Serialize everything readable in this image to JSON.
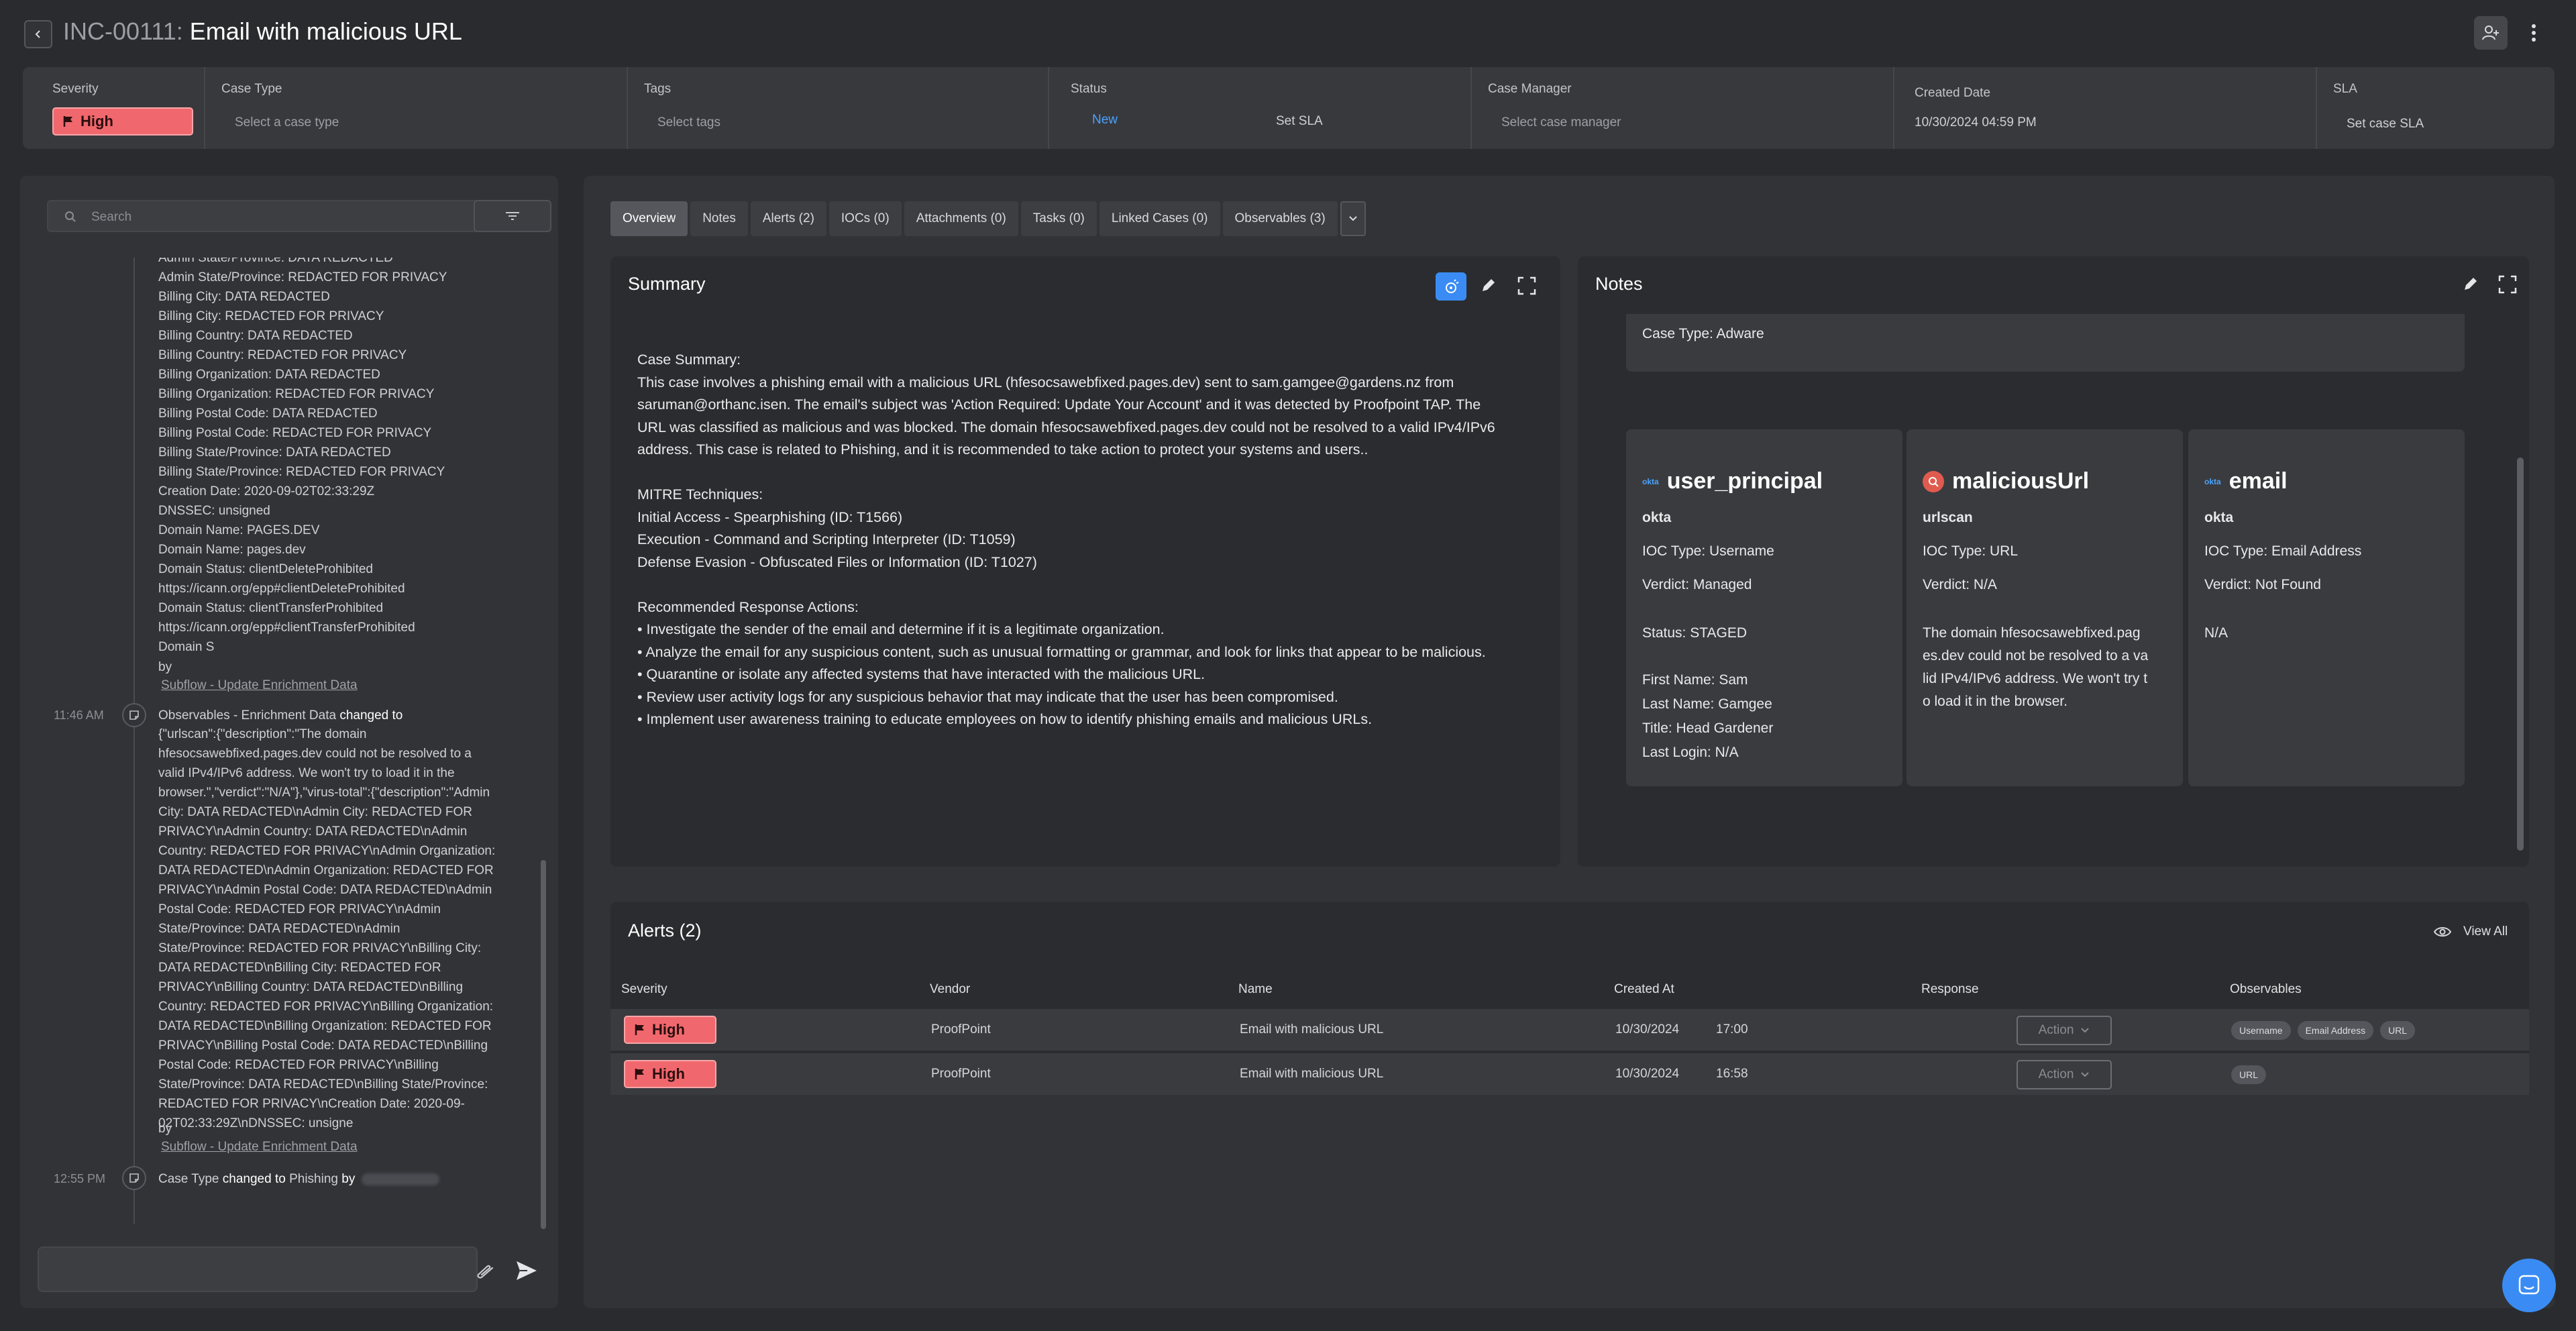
{
  "header": {
    "case_id": "INC-00111:",
    "case_title": "Email with malicious URL"
  },
  "fields": {
    "severity_label": "Severity",
    "severity_value": "High",
    "case_type_label": "Case Type",
    "case_type_placeholder": "Select a case type",
    "tags_label": "Tags",
    "tags_placeholder": "Select tags",
    "status_label": "Status",
    "status_value": "New",
    "set_sla": "Set SLA",
    "case_manager_label": "Case Manager",
    "case_manager_placeholder": "Select case manager",
    "created_label": "Created Date",
    "created_value": "10/30/2024 04:59 PM",
    "sla_label": "SLA",
    "sla_placeholder": "Set case SLA"
  },
  "activity": {
    "search_placeholder": "Search",
    "lines": [
      "Admin State/Province: DATA REDACTED",
      "Admin State/Province: REDACTED FOR PRIVACY",
      "Billing City: DATA REDACTED",
      "Billing City: REDACTED FOR PRIVACY",
      "Billing Country: DATA REDACTED",
      "Billing Country: REDACTED FOR PRIVACY",
      "Billing Organization: DATA REDACTED",
      "Billing Organization: REDACTED FOR PRIVACY",
      "Billing Postal Code: DATA REDACTED",
      "Billing Postal Code: REDACTED FOR PRIVACY",
      "Billing State/Province: DATA REDACTED",
      "Billing State/Province: REDACTED FOR PRIVACY",
      "Creation Date: 2020-09-02T02:33:29Z",
      "DNSSEC: unsigned",
      "Domain Name: PAGES.DEV",
      "Domain Name: pages.dev",
      "Domain Status: clientDeleteProhibited",
      "https://icann.org/epp#clientDeleteProhibited",
      "Domain Status: clientTransferProhibited",
      "https://icann.org/epp#clientTransferProhibited",
      "Domain S"
    ],
    "by": "by",
    "link1": "Subflow - Update Enrichment Data",
    "entry2_time": "11:46 AM",
    "entry2_subject": "Observables - Enrichment Data",
    "entry2_changed": "changed to",
    "entry2_lines": [
      "{\"urlscan\":{\"description\":\"The domain",
      "hfesocsawebfixed.pages.dev could not be resolved to a",
      "valid IPv4/IPv6 address. We won't try to load it in the",
      "browser.\",\"verdict\":\"N/A\"},\"virus-total\":{\"description\":\"Admin",
      "City: DATA REDACTED\\nAdmin City: REDACTED FOR",
      "PRIVACY\\nAdmin Country: DATA REDACTED\\nAdmin",
      "Country: REDACTED FOR PRIVACY\\nAdmin Organization:",
      "DATA REDACTED\\nAdmin Organization: REDACTED FOR",
      "PRIVACY\\nAdmin Postal Code: DATA REDACTED\\nAdmin",
      "Postal Code: REDACTED FOR PRIVACY\\nAdmin",
      "State/Province: DATA REDACTED\\nAdmin",
      "State/Province: REDACTED FOR PRIVACY\\nBilling City:",
      "DATA REDACTED\\nBilling City: REDACTED FOR",
      "PRIVACY\\nBilling Country: DATA REDACTED\\nBilling",
      "Country: REDACTED FOR PRIVACY\\nBilling Organization:",
      "DATA REDACTED\\nBilling Organization: REDACTED FOR",
      "PRIVACY\\nBilling Postal Code: DATA REDACTED\\nBilling",
      "Postal Code: REDACTED FOR PRIVACY\\nBilling",
      "State/Province: DATA REDACTED\\nBilling State/Province:",
      "REDACTED FOR PRIVACY\\nCreation Date: 2020-09-",
      "02T02:33:29Z\\nDNSSEC: unsigne"
    ],
    "link2": "Subflow - Update Enrichment Data",
    "entry3_time": "12:55 PM",
    "entry3_subject": "Case Type",
    "entry3_changed": "changed to",
    "entry3_value": "Phishing",
    "entry3_by": "by"
  },
  "tabs": [
    "Overview",
    "Notes",
    "Alerts (2)",
    "IOCs (0)",
    "Attachments (0)",
    "Tasks (0)",
    "Linked Cases (0)",
    "Observables (3)"
  ],
  "summary": {
    "title": "Summary",
    "lines": [
      "Case Summary:",
      "This case involves a phishing email with a malicious URL (hfesocsawebfixed.pages.dev) sent to sam.gamgee@gardens.nz from",
      "saruman@orthanc.isen. The email's subject was 'Action Required: Update Your Account' and it was detected by Proofpoint TAP. The",
      "URL was classified as malicious and was blocked. The domain hfesocsawebfixed.pages.dev could not be resolved to a valid IPv4/IPv6",
      "address. This case is related to Phishing, and it is recommended to take action to protect your systems and users..",
      "",
      "MITRE Techniques:",
      "Initial Access - Spearphishing (ID: T1566)",
      "Execution - Command and Scripting Interpreter (ID: T1059)",
      "Defense Evasion - Obfuscated Files or Information (ID: T1027)",
      "",
      "Recommended Response Actions:",
      "• Investigate the sender of the email and determine if it is a legitimate organization.",
      "• Analyze the email for any suspicious content, such as unusual formatting or grammar, and look for links that appear to be malicious.",
      "• Quarantine or isolate any affected systems that have interacted with the malicious URL.",
      "• Review user activity logs for any suspicious behavior that may indicate that the user has been compromised.",
      "• Implement user awareness training to educate employees on how to identify phishing emails and malicious URLs."
    ]
  },
  "notes": {
    "title": "Notes",
    "case_type_line": "Case Type: Adware",
    "cards": [
      {
        "logo": "okta",
        "title": "user_principal",
        "source": "okta",
        "ioc_type": "IOC Type: Username",
        "verdict": "Verdict: Managed",
        "status": "Status: STAGED",
        "details": [
          "First Name: Sam",
          "Last Name: Gamgee",
          "Title: Head Gardener",
          "Last Login: N/A"
        ]
      },
      {
        "title": "maliciousUrl",
        "source": "urlscan",
        "ioc_type": "IOC Type: URL",
        "verdict": "Verdict: N/A",
        "details": [
          "The domain hfesocsawebfixed.pag",
          "es.dev could not be resolved to a va",
          "lid IPv4/IPv6 address. We won't try t",
          "o load it in the browser."
        ]
      },
      {
        "logo": "okta",
        "title": "email",
        "source": "okta",
        "ioc_type": "IOC Type: Email Address",
        "verdict": "Verdict: Not Found",
        "details": [
          "N/A"
        ]
      }
    ]
  },
  "alerts": {
    "title": "Alerts (2)",
    "view_all": "View All",
    "columns": [
      "Severity",
      "Vendor",
      "Name",
      "Created At",
      "Response",
      "Observables"
    ],
    "rows": [
      {
        "severity": "High",
        "vendor": "ProofPoint",
        "name": "Email with malicious URL",
        "date": "10/30/2024",
        "time": "17:00",
        "action": "Action",
        "observables": [
          "Username",
          "Email Address",
          "URL"
        ]
      },
      {
        "severity": "High",
        "vendor": "ProofPoint",
        "name": "Email with malicious URL",
        "date": "10/30/2024",
        "time": "16:58",
        "action": "Action",
        "observables": [
          "URL"
        ]
      }
    ]
  },
  "colors": {
    "background": "#2a2b2e",
    "panel": "#323337",
    "severity_high": "#f0686d",
    "accent_blue": "#4aa3ff"
  }
}
